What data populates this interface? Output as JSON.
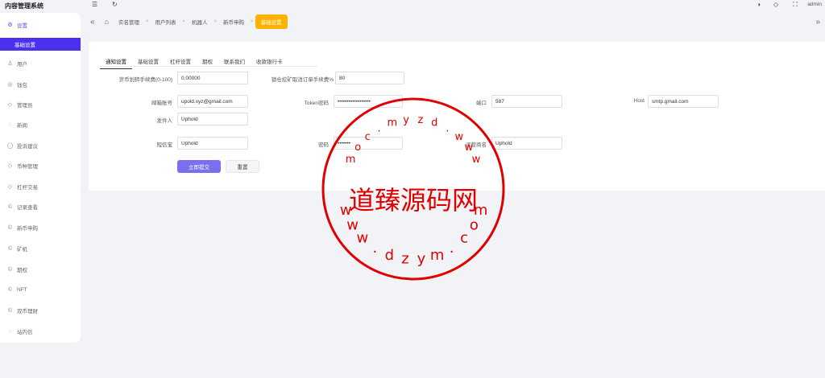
{
  "app": {
    "title": "内容管理系统"
  },
  "sidebar": {
    "items": [
      {
        "label": "设置",
        "icon": "gear-icon",
        "glyph": "⚙"
      },
      {
        "label": "基础设置",
        "icon": "",
        "glyph": ""
      },
      {
        "label": "用户",
        "icon": "user-icon",
        "glyph": "♙"
      },
      {
        "label": "钱包",
        "icon": "wallet-icon",
        "glyph": "◎"
      },
      {
        "label": "管理员",
        "icon": "shield-icon",
        "glyph": "◇"
      },
      {
        "label": "新闻",
        "icon": "tag-icon",
        "glyph": "◌"
      },
      {
        "label": "投诉建议",
        "icon": "chat-icon",
        "glyph": "◯"
      },
      {
        "label": "币种管理",
        "icon": "diamond-icon",
        "glyph": "◇"
      },
      {
        "label": "杠杆交易",
        "icon": "diamond-icon",
        "glyph": "◇"
      },
      {
        "label": "记录查看",
        "icon": "coin-icon",
        "glyph": "©"
      },
      {
        "label": "新币申购",
        "icon": "coin-icon",
        "glyph": "©"
      },
      {
        "label": "矿机",
        "icon": "coin-icon",
        "glyph": "©"
      },
      {
        "label": "期权",
        "icon": "coin-icon",
        "glyph": "©"
      },
      {
        "label": "NFT",
        "icon": "coin-icon",
        "glyph": "©"
      },
      {
        "label": "双币理财",
        "icon": "coin-icon",
        "glyph": "©"
      },
      {
        "label": "站内信",
        "icon": "message-icon",
        "glyph": "◌"
      }
    ]
  },
  "topbar": {
    "admin": "admin"
  },
  "tabs": {
    "items": [
      "实名管理",
      "用户列表",
      "机器人",
      "新币申购",
      "基础设置"
    ],
    "separator": "×"
  },
  "form": {
    "subtabs": [
      "通知设置",
      "基础设置",
      "杠杆设置",
      "期权",
      "联系我们",
      "收款银行卡"
    ],
    "fields": {
      "transfer_fee": {
        "label": "货币划转手续费(0-100)",
        "value": "0.00000"
      },
      "miner_fee": {
        "label": "锁仓挖矿取消订单手续费%",
        "value": "80"
      },
      "email": {
        "label": "邮箱账号",
        "value": "upold.xyz@gmail.com"
      },
      "token": {
        "label": "Token密码",
        "value": "••••••••••••••••••"
      },
      "port": {
        "label": "端口",
        "value": "587"
      },
      "host": {
        "label": "Host",
        "value": "smtp.gmail.com"
      },
      "sender": {
        "label": "发件人",
        "value": "Uphold"
      },
      "sms": {
        "label": "短信宝",
        "value": "Uphold"
      },
      "password": {
        "label": "密码",
        "value": "•••••••"
      },
      "operator": {
        "label": "运营商名",
        "value": "Uphold"
      }
    },
    "submit": "立即提交",
    "reset": "重置"
  },
  "watermark": {
    "center": "道臻源码网",
    "ring": "www.dzym.com"
  },
  "colors": {
    "accent": "#4b30f0",
    "tab_active": "#ffb300",
    "stamp": "#e00000"
  }
}
